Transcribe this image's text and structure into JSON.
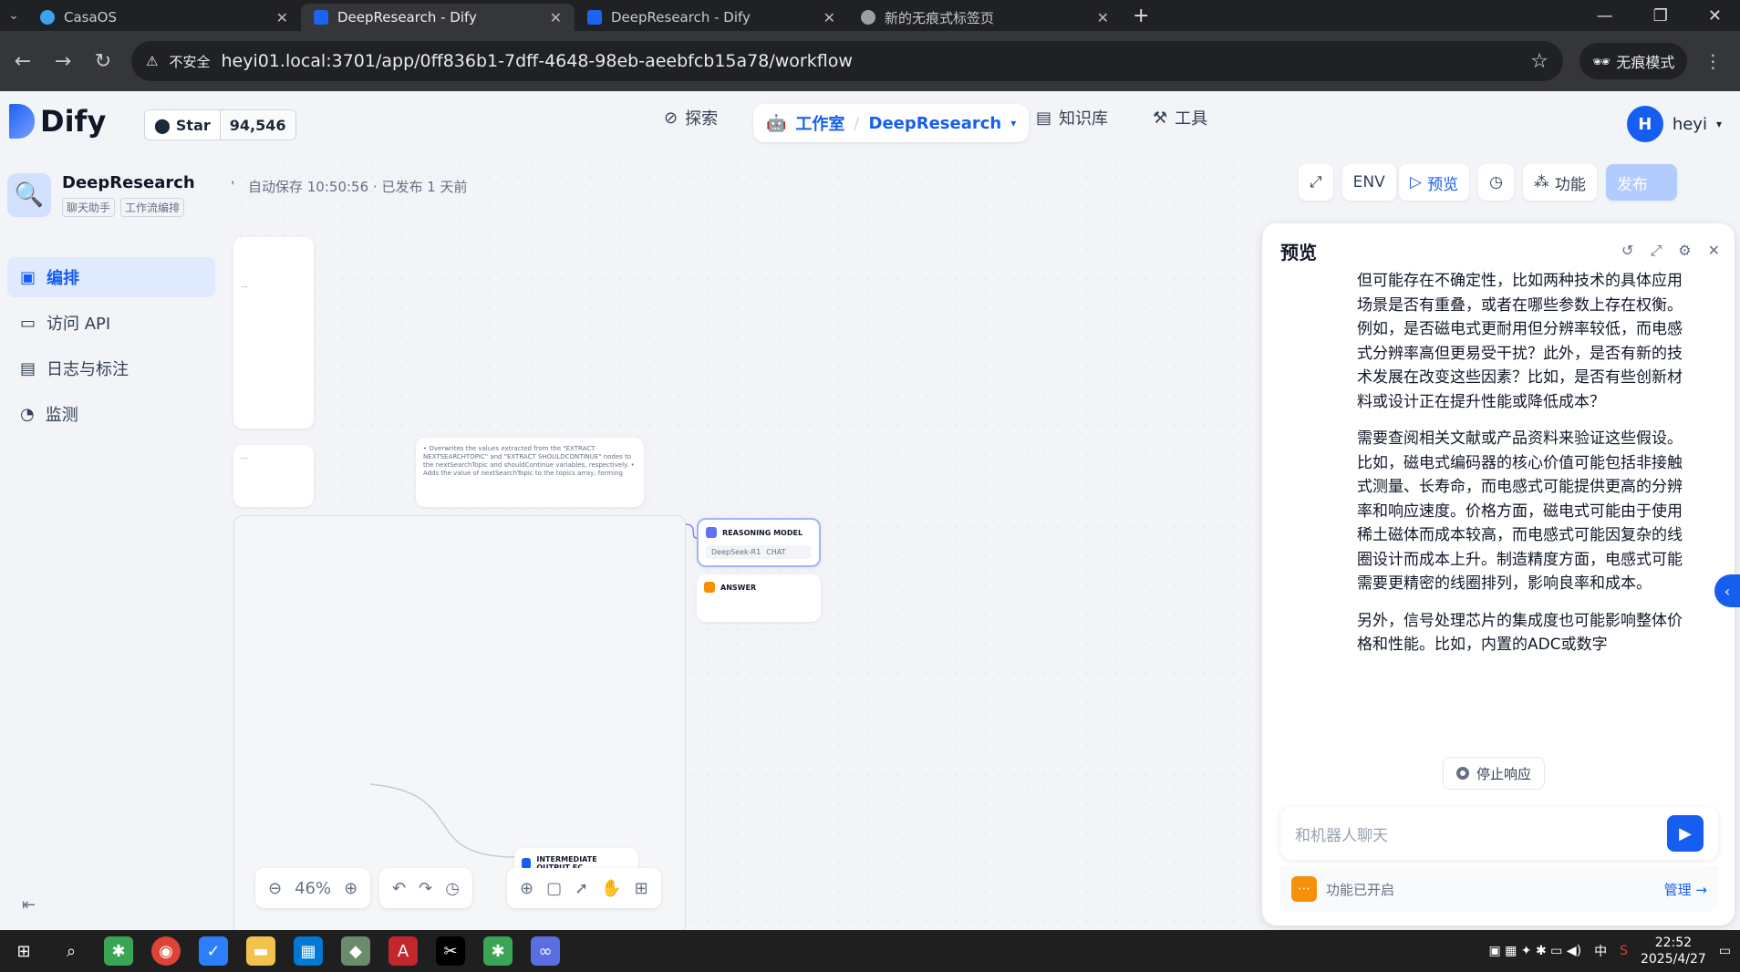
{
  "browser": {
    "tabs": [
      {
        "title": "CasaOS",
        "color": "#3ba3f5"
      },
      {
        "title": "DeepResearch - Dify",
        "color": "#1c64f2"
      },
      {
        "title": "DeepResearch - Dify",
        "color": "#1c64f2"
      },
      {
        "title": "新的无痕式标签页",
        "color": "#9aa0a6"
      }
    ],
    "security_label": "不安全",
    "url": "heyi01.local:3701/app/0ff836b1-7dff-4648-98eb-aeebfcb15a78/workflow",
    "incognito_label": "无痕模式"
  },
  "header": {
    "logo_text": "Dify",
    "star_label": "Star",
    "star_count": "94,546",
    "nav_explore": "探索",
    "workspace_label": "工作室",
    "workspace_app": "DeepResearch",
    "nav_knowledge": "知识库",
    "nav_tools": "工具",
    "user_initial": "H",
    "user_name": "heyi"
  },
  "sidebar": {
    "app_name": "DeepResearch",
    "tags": [
      "聊天助手",
      "工作流编排"
    ],
    "items": [
      {
        "label": "编排",
        "active": true
      },
      {
        "label": "访问 API",
        "active": false
      },
      {
        "label": "日志与标注",
        "active": false
      },
      {
        "label": "监测",
        "active": false
      }
    ]
  },
  "canvas": {
    "autosave_info": "自动保存 10:50:56 · 已发布 1 天前",
    "zoom": "46%",
    "nodes": {
      "reasoning_title": "REASONING MODEL",
      "reasoning_model": "DeepSeek-R1",
      "reasoning_badge": "CHAT",
      "answer_title": "ANSWER",
      "intermediate_title": "INTERMEDIATE OUTPUT FC",
      "note_text": "• Overwrites the values extracted from the \"EXTRACT NEXTSEARCHTOPIC\" and \"EXTRACT SHOULDCONTINUE\" nodes to the nextSearchTopic and shouldContinue variables, respectively. • Adds the value of nextSearchTopic to the topics array, forming"
    }
  },
  "toolbar": {
    "preview_label": "预览",
    "features_label": "功能",
    "publish_label": "发布"
  },
  "preview": {
    "title": "预览",
    "paragraphs": [
      "但可能存在不确定性，比如两种技术的具体应用场景是否有重叠，或者在哪些参数上存在权衡。例如，是否磁电式更耐用但分辨率较低，而电感式分辨率高但更易受干扰？此外，是否有新的技术发展在改变这些因素？比如，是否有些创新材料或设计正在提升性能或降低成本？",
      "需要查阅相关文献或产品资料来验证这些假设。比如，磁电式编码器的核心价值可能包括非接触式测量、长寿命，而电感式可能提供更高的分辨率和响应速度。价格方面，磁电式可能由于使用稀土磁体而成本较高，而电感式可能因复杂的线圈设计而成本上升。制造精度方面，电感式可能需要更精密的线圈排列，影响良率和成本。",
      "另外，信号处理芯片的集成度也可能影响整体价格和性能。比如，内置的ADC或数字"
    ],
    "stop_label": "停止响应",
    "input_placeholder": "和机器人聊天",
    "features_enabled": "功能已开启",
    "manage_label": "管理"
  },
  "taskbar": {
    "time": "22:52",
    "date": "2025/4/27",
    "ime": "中"
  }
}
